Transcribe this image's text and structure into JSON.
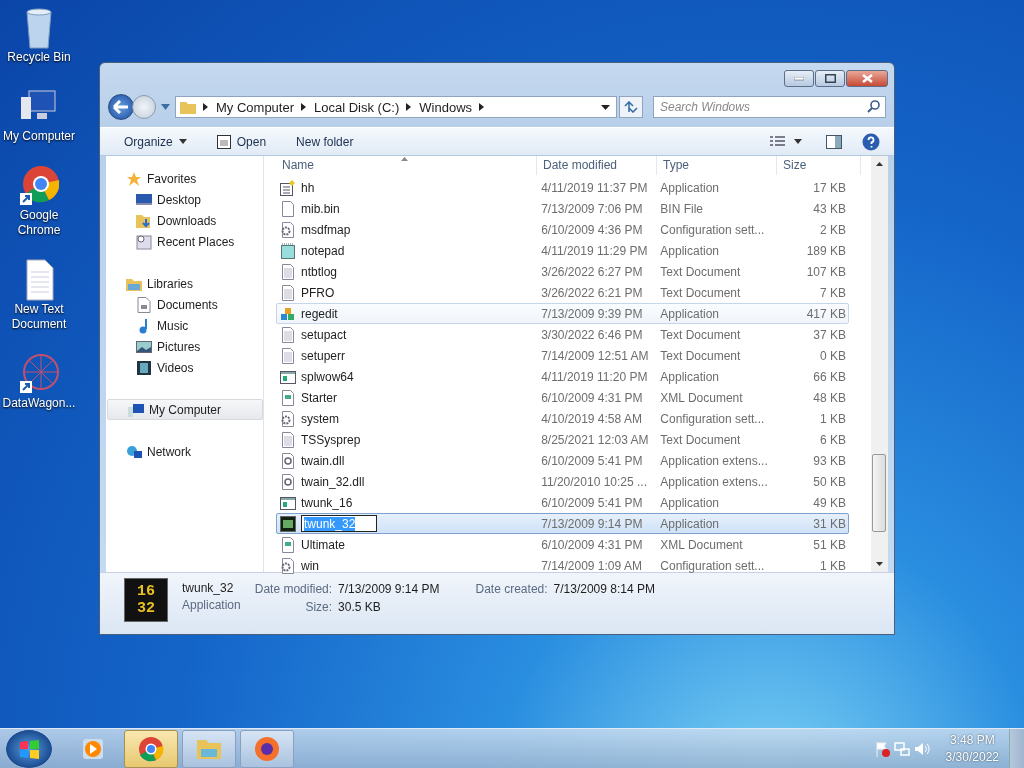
{
  "desktop_icons": [
    {
      "label": "Recycle Bin",
      "kind": "recycle",
      "shortcut": false
    },
    {
      "label": "My Computer",
      "kind": "computer",
      "shortcut": false
    },
    {
      "label": "Google Chrome",
      "kind": "chrome",
      "shortcut": true
    },
    {
      "label": "New Text Document",
      "kind": "text",
      "shortcut": false
    },
    {
      "label": "DataWagon...",
      "kind": "star",
      "shortcut": true
    }
  ],
  "window": {
    "breadcrumb": [
      "My Computer",
      "Local Disk (C:)",
      "Windows"
    ],
    "search": {
      "placeholder": "Search Windows"
    },
    "toolbar": [
      {
        "label": "Organize",
        "kind": "menu"
      },
      {
        "label": "Open",
        "kind": "open"
      },
      {
        "label": "New folder",
        "kind": "plain"
      }
    ],
    "nav": [
      {
        "label": "Favorites",
        "kind": "star",
        "selected": false,
        "children": [
          {
            "label": "Desktop",
            "kind": "desktop",
            "selected": false
          },
          {
            "label": "Downloads",
            "kind": "downloads",
            "selected": false
          },
          {
            "label": "Recent Places",
            "kind": "recent",
            "selected": false
          }
        ]
      },
      {
        "label": "Libraries",
        "kind": "library",
        "selected": false,
        "children": [
          {
            "label": "Documents",
            "kind": "document",
            "selected": false
          },
          {
            "label": "Music",
            "kind": "music",
            "selected": false
          },
          {
            "label": "Pictures",
            "kind": "pictures",
            "selected": false
          },
          {
            "label": "Videos",
            "kind": "videos",
            "selected": false
          }
        ]
      },
      {
        "label": "My Computer",
        "kind": "computer",
        "selected": true
      },
      {
        "label": "Network",
        "kind": "network",
        "selected": false
      }
    ],
    "columns": [
      "Name",
      "Date modified",
      "Type",
      "Size"
    ],
    "rows": [
      {
        "name": "hh",
        "date": "4/11/2019 11:37 PM",
        "type": "Application",
        "size": "17 KB",
        "kind": "help",
        "selected": false,
        "hovered": false
      },
      {
        "name": "mib.bin",
        "date": "7/13/2009 7:06 PM",
        "type": "BIN File",
        "size": "43 KB",
        "kind": "blank",
        "selected": false,
        "hovered": false
      },
      {
        "name": "msdfmap",
        "date": "6/10/2009 4:36 PM",
        "type": "Configuration sett...",
        "size": "2 KB",
        "kind": "config",
        "selected": false,
        "hovered": false
      },
      {
        "name": "notepad",
        "date": "4/11/2019 11:29 PM",
        "type": "Application",
        "size": "189 KB",
        "kind": "notepad",
        "selected": false,
        "hovered": false
      },
      {
        "name": "ntbtlog",
        "date": "3/26/2022 6:27 PM",
        "type": "Text Document",
        "size": "107 KB",
        "kind": "text",
        "selected": false,
        "hovered": false
      },
      {
        "name": "PFRO",
        "date": "3/26/2022 6:21 PM",
        "type": "Text Document",
        "size": "7 KB",
        "kind": "text",
        "selected": false,
        "hovered": false
      },
      {
        "name": "regedit",
        "date": "7/13/2009 9:39 PM",
        "type": "Application",
        "size": "417 KB",
        "kind": "regedit",
        "selected": false,
        "hovered": true
      },
      {
        "name": "setupact",
        "date": "3/30/2022 6:46 PM",
        "type": "Text Document",
        "size": "37 KB",
        "kind": "text",
        "selected": false,
        "hovered": false
      },
      {
        "name": "setuperr",
        "date": "7/14/2009 12:51 AM",
        "type": "Text Document",
        "size": "0 KB",
        "kind": "text",
        "selected": false,
        "hovered": false
      },
      {
        "name": "splwow64",
        "date": "4/11/2019 11:20 PM",
        "type": "Application",
        "size": "66 KB",
        "kind": "app",
        "selected": false,
        "hovered": false
      },
      {
        "name": "Starter",
        "date": "6/10/2009 4:31 PM",
        "type": "XML Document",
        "size": "48 KB",
        "kind": "xml",
        "selected": false,
        "hovered": false
      },
      {
        "name": "system",
        "date": "4/10/2019 4:58 AM",
        "type": "Configuration sett...",
        "size": "1 KB",
        "kind": "config",
        "selected": false,
        "hovered": false
      },
      {
        "name": "TSSysprep",
        "date": "8/25/2021 12:03 AM",
        "type": "Text Document",
        "size": "6 KB",
        "kind": "text",
        "selected": false,
        "hovered": false
      },
      {
        "name": "twain.dll",
        "date": "6/10/2009 5:41 PM",
        "type": "Application extens...",
        "size": "93 KB",
        "kind": "dll",
        "selected": false,
        "hovered": false
      },
      {
        "name": "twain_32.dll",
        "date": "11/20/2010 10:25 ...",
        "type": "Application extens...",
        "size": "50 KB",
        "kind": "dll",
        "selected": false,
        "hovered": false
      },
      {
        "name": "twunk_16",
        "date": "6/10/2009 5:41 PM",
        "type": "Application",
        "size": "49 KB",
        "kind": "app",
        "selected": false,
        "hovered": false
      },
      {
        "name": "twunk_32",
        "date": "7/13/2009 9:14 PM",
        "type": "Application",
        "size": "31 KB",
        "kind": "twunk",
        "selected": true,
        "hovered": false
      },
      {
        "name": "Ultimate",
        "date": "6/10/2009 4:31 PM",
        "type": "XML Document",
        "size": "51 KB",
        "kind": "xml",
        "selected": false,
        "hovered": false
      },
      {
        "name": "win",
        "date": "7/14/2009 1:09 AM",
        "type": "Configuration sett...",
        "size": "1 KB",
        "kind": "config",
        "selected": false,
        "hovered": false
      }
    ],
    "details": {
      "name": "twunk_32",
      "type": "Application",
      "thumb_text": [
        "16",
        "32"
      ],
      "fields": [
        {
          "label": "Date modified:",
          "value": "7/13/2009 9:14 PM"
        },
        {
          "label": "Size:",
          "value": "30.5 KB"
        },
        {
          "label": "Date created:",
          "value": "7/13/2009 8:14 PM"
        }
      ]
    }
  },
  "taskbar": {
    "apps": [
      {
        "kind": "media",
        "active": false
      },
      {
        "kind": "chrome",
        "active": true
      },
      {
        "kind": "explorer",
        "active": false
      },
      {
        "kind": "firefox",
        "active": false
      }
    ],
    "time": "3:48 PM",
    "date": "3/30/2022"
  }
}
